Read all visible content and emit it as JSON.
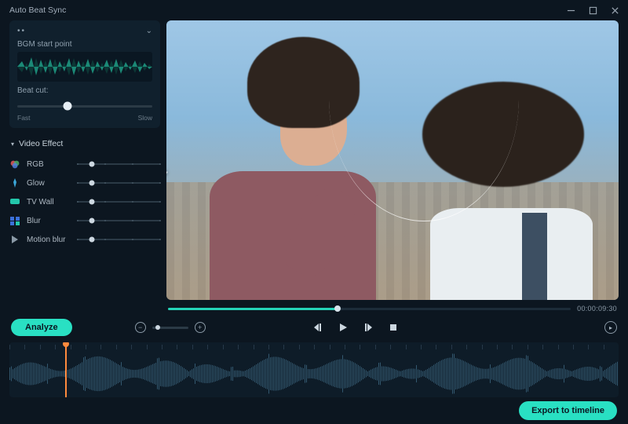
{
  "window": {
    "title": "Auto Beat Sync"
  },
  "sidebar": {
    "bgm_label": "BGM start point",
    "beatcut_label": "Beat cut:",
    "beatcut_min": "Fast",
    "beatcut_max": "Slow",
    "beatcut_value_pct": 37,
    "section_title": "Video Effect",
    "effects": [
      {
        "icon": "rgb-icon",
        "name": "RGB",
        "value_pct": 18
      },
      {
        "icon": "glow-icon",
        "name": "Glow",
        "value_pct": 18
      },
      {
        "icon": "tvwall-icon",
        "name": "TV Wall",
        "value_pct": 18
      },
      {
        "icon": "blur-icon",
        "name": "Blur",
        "value_pct": 18
      },
      {
        "icon": "motion-icon",
        "name": "Motion blur",
        "value_pct": 18
      }
    ]
  },
  "preview": {
    "scrub_pct": 42,
    "timecode": "00:00:09:30"
  },
  "midbar": {
    "analyze_label": "Analyze",
    "zoom_pct": 16
  },
  "timeline": {
    "cursor_pct": 9.2
  },
  "footer": {
    "export_label": "Export to timeline"
  },
  "colors": {
    "accent": "#29e0c3",
    "cursor": "#ff8a3d"
  }
}
